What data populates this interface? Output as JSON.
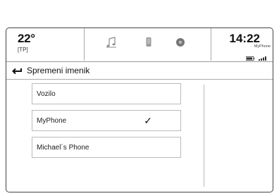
{
  "status_bar": {
    "temperature": "22°",
    "traffic_program": "[TP]",
    "time": "14:22",
    "phone_name": "MyPhone",
    "icons": [
      "music-note-icon",
      "phone-icon",
      "settings-icon",
      "battery-icon",
      "signal-icon"
    ]
  },
  "header": {
    "back_icon": "back-arrow-icon",
    "title": "Spremeni imenik"
  },
  "phonebook_list": {
    "items": [
      {
        "label": "Vozilo",
        "selected": false
      },
      {
        "label": "MyPhone",
        "selected": true
      },
      {
        "label": "Michael´s Phone",
        "selected": false
      }
    ],
    "check_glyph": "✓"
  }
}
